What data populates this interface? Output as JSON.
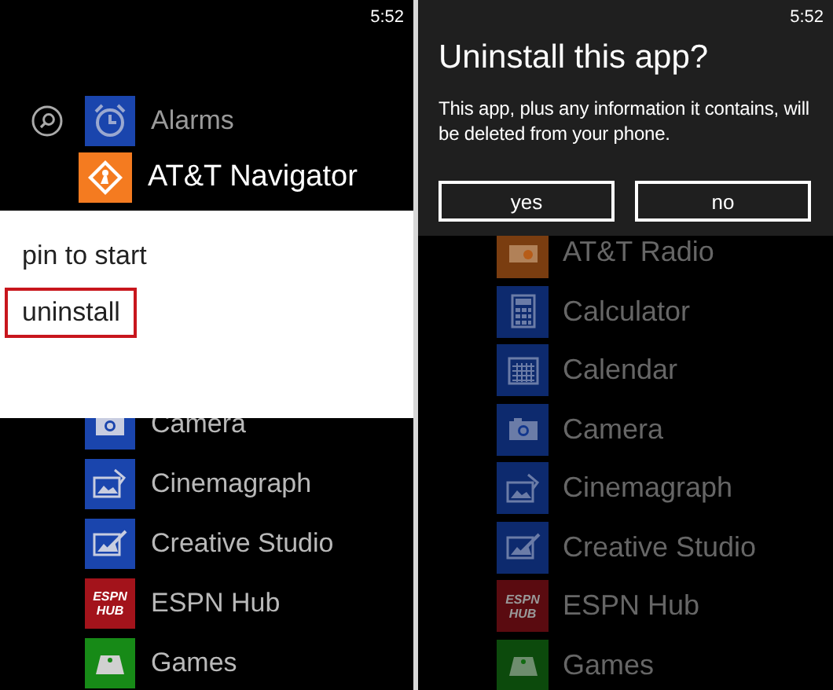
{
  "left_screen": {
    "status_time": "5:52",
    "top_apps": [
      {
        "name": "Alarms",
        "kind": "alarm",
        "color": "#1a45ad",
        "selected": false
      },
      {
        "name": "AT&T Navigator",
        "kind": "navigator",
        "color": "#f47b20",
        "selected": true
      }
    ],
    "context_menu": {
      "items": [
        {
          "label": "pin to start",
          "selected": false
        },
        {
          "label": "uninstall",
          "selected": true
        }
      ]
    },
    "apps": [
      {
        "name": "Camera",
        "kind": "camera",
        "color": "#1a45ad"
      },
      {
        "name": "Cinemagraph",
        "kind": "cinemagraph",
        "color": "#1a45ad"
      },
      {
        "name": "Creative Studio",
        "kind": "creative",
        "color": "#1a45ad"
      },
      {
        "name": "ESPN Hub",
        "kind": "espn",
        "color": "#a3131b",
        "tile_lines": [
          "ESPN",
          "HUB"
        ]
      },
      {
        "name": "Games",
        "kind": "games",
        "color": "#178a17"
      }
    ]
  },
  "right_screen": {
    "status_time": "5:52",
    "dialog": {
      "title": "Uninstall this app?",
      "message": "This app, plus any information it contains, will be deleted from your phone.",
      "buttons": [
        "yes",
        "no"
      ]
    },
    "dimmed": true,
    "apps": [
      {
        "name": "AT&T Radio",
        "kind": "radio",
        "color": "#7a3d10"
      },
      {
        "name": "Calculator",
        "kind": "calculator",
        "color": "#0d2a6e"
      },
      {
        "name": "Calendar",
        "kind": "calendar",
        "color": "#0d2a6e"
      },
      {
        "name": "Camera",
        "kind": "camera",
        "color": "#0d2a6e"
      },
      {
        "name": "Cinemagraph",
        "kind": "cinemagraph",
        "color": "#0d2a6e"
      },
      {
        "name": "Creative Studio",
        "kind": "creative",
        "color": "#0d2a6e"
      },
      {
        "name": "ESPN Hub",
        "kind": "espn",
        "color": "#5a0b10",
        "tile_lines": [
          "ESPN",
          "HUB"
        ]
      },
      {
        "name": "Games",
        "kind": "games",
        "color": "#0c4a0c"
      }
    ]
  }
}
